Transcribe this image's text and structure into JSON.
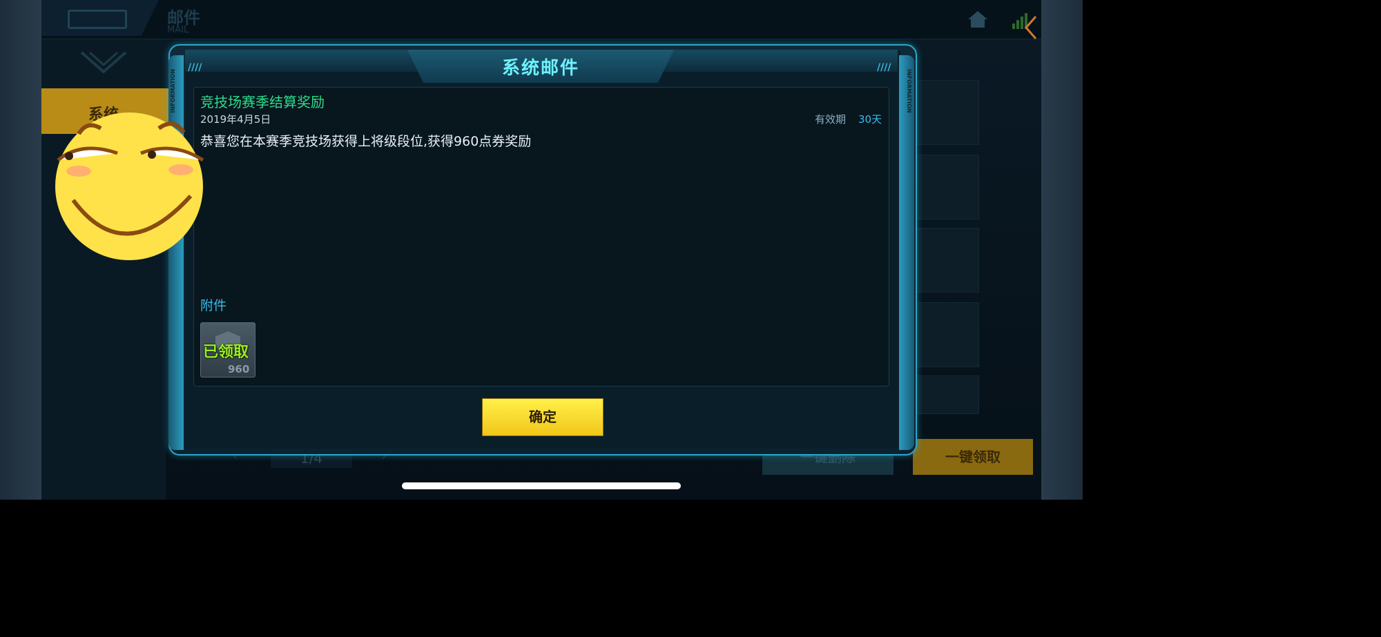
{
  "header": {
    "title": "邮件",
    "subtitle": "MAIL"
  },
  "sidebar": {
    "tabs": [
      {
        "label": "系统"
      }
    ]
  },
  "modal": {
    "title": "系统邮件",
    "rail_text": "INFORMATION",
    "mail": {
      "subject": "竞技场赛季结算奖励",
      "date": "2019年4月5日",
      "validity_label": "有效期",
      "validity_value": "30天",
      "body": "恭喜您在本赛季竞技场获得上将级段位,获得960点券奖励"
    },
    "attachments_label": "附件",
    "attachment": {
      "status": "已领取",
      "count": "960"
    },
    "confirm_label": "确定"
  },
  "footer": {
    "pager": "1/4",
    "delete_all_label": "一键删除",
    "claim_all_label": "一键领取"
  },
  "colors": {
    "accent_cyan": "#6ef2ff",
    "subject_green": "#2edc8c",
    "validity_blue": "#38bdf0",
    "claimed_green": "#9af01e",
    "button_yellow": "#f2c618"
  }
}
